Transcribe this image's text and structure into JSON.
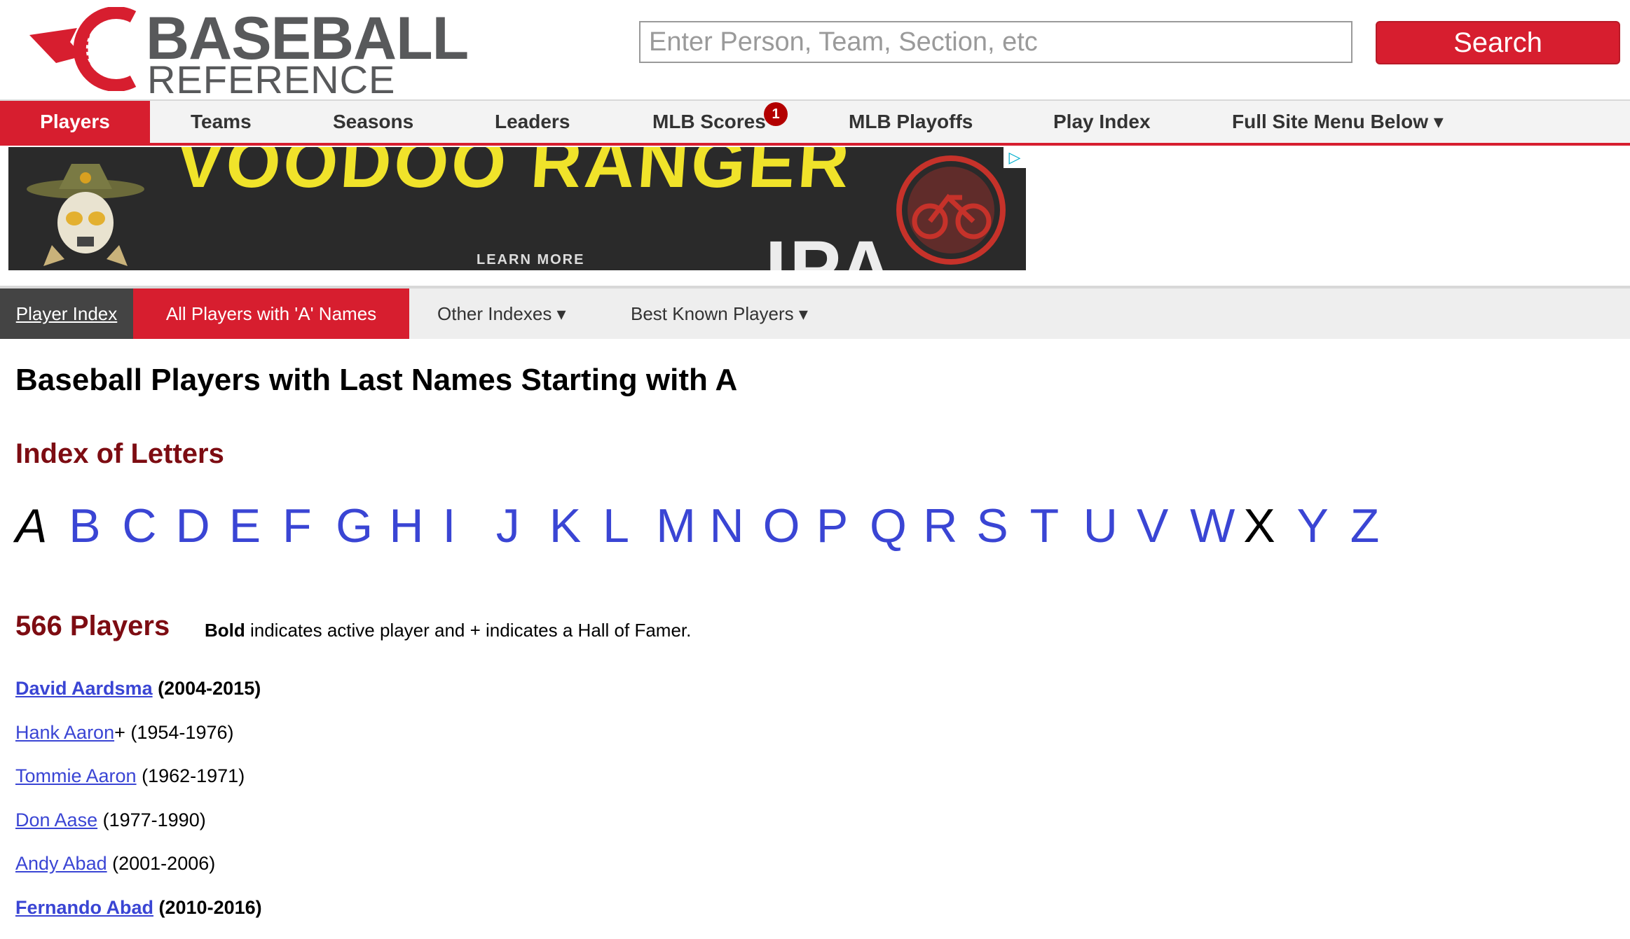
{
  "logo": {
    "line1": "BASEBALL",
    "line2": "REFERENCE"
  },
  "search": {
    "placeholder": "Enter Person, Team, Section, etc",
    "button_label": "Search"
  },
  "nav": {
    "items": [
      {
        "label": "Players"
      },
      {
        "label": "Teams"
      },
      {
        "label": "Seasons"
      },
      {
        "label": "Leaders"
      },
      {
        "label": "MLB Scores"
      },
      {
        "label": "MLB Playoffs"
      },
      {
        "label": "Play Index"
      },
      {
        "label": "Full Site Menu Below ▾"
      }
    ],
    "scores_badge": "1"
  },
  "ad": {
    "headline": "VOODOO RANGER",
    "cta": "LEARN MORE",
    "product": "IPA"
  },
  "subnav": {
    "player_index": "Player Index",
    "all_players_a": "All Players with 'A' Names",
    "other_indexes": "Other Indexes ▾",
    "best_known": "Best Known Players ▾"
  },
  "page": {
    "title": "Baseball Players with Last Names Starting with A",
    "letters_heading": "Index of Letters",
    "letters": [
      "A",
      "B",
      "C",
      "D",
      "E",
      "F",
      "G",
      "H",
      "I",
      "J",
      "K",
      "L",
      "M",
      "N",
      "O",
      "P",
      "Q",
      "R",
      "S",
      "T",
      "U",
      "V",
      "W",
      "X",
      "Y",
      "Z"
    ],
    "count_heading": "566 Players",
    "note_bold": "Bold",
    "note_rest": " indicates active player and + indicates a Hall of Famer."
  },
  "players": [
    {
      "name": "David Aardsma",
      "suffix": "",
      "years": " (2004-2015)",
      "active": true
    },
    {
      "name": "Hank Aaron",
      "suffix": "+",
      "years": " (1954-1976)",
      "active": false
    },
    {
      "name": "Tommie Aaron",
      "suffix": "",
      "years": " (1962-1971)",
      "active": false
    },
    {
      "name": "Don Aase",
      "suffix": "",
      "years": " (1977-1990)",
      "active": false
    },
    {
      "name": "Andy Abad",
      "suffix": "",
      "years": " (2001-2006)",
      "active": false
    },
    {
      "name": "Fernando Abad",
      "suffix": "",
      "years": " (2010-2016)",
      "active": true
    }
  ],
  "colors": {
    "brand_red": "#d71e2f",
    "heading_red": "#7d0c12",
    "link_blue": "#3a45d4"
  }
}
